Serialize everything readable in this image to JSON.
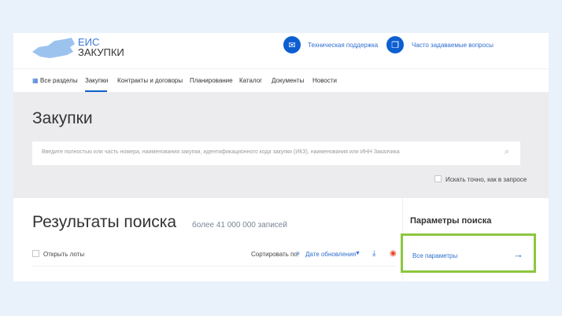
{
  "logo": {
    "line1": "ЕИС",
    "line2": "ЗАКУПКИ"
  },
  "header": {
    "support": "Техническая поддержка",
    "faq": "Часто задаваемые вопросы"
  },
  "nav": {
    "all": "Все разделы",
    "items": [
      "Закупки",
      "Контракты и договоры",
      "Планирование",
      "Каталог",
      "Документы",
      "Новости"
    ]
  },
  "page_title": "Закупки",
  "search": {
    "placeholder": "Введите полностью или часть номера, наименования закупки, идентификационного кода закупки (ИКЗ), наименования или ИНН Заказчика",
    "exact": "Искать точно, как в запросе"
  },
  "results": {
    "title": "Результаты поиска",
    "count": "более 41 000 000 записей",
    "open_lots": "Открыть лоты",
    "sort_label": "Сортировать по:",
    "sort_value": "Дате обновления"
  },
  "params": {
    "title": "Параметры поиска",
    "all": "Все параметры"
  },
  "colors": {
    "accent": "#0d5fd1",
    "highlight": "#8dc63f"
  }
}
